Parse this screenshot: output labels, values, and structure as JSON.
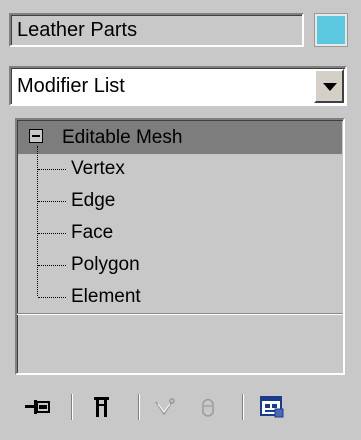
{
  "object_name": {
    "value": "Leather Parts",
    "color": "#5bc8e0"
  },
  "modifier_list": {
    "selected": "Modifier List"
  },
  "stack": {
    "root_label": "Editable Mesh",
    "expanded": true,
    "sub_objects": [
      {
        "label": "Vertex"
      },
      {
        "label": "Edge"
      },
      {
        "label": "Face"
      },
      {
        "label": "Polygon"
      },
      {
        "label": "Element"
      }
    ]
  },
  "toolbar": {
    "buttons": [
      {
        "icon": "pin-stack-icon",
        "enabled": true
      },
      {
        "icon": "show-end-result-icon",
        "enabled": true
      },
      {
        "icon": "make-unique-icon",
        "enabled": false
      },
      {
        "icon": "remove-modifier-icon",
        "enabled": false
      },
      {
        "icon": "configure-modifier-sets-icon",
        "enabled": true
      }
    ]
  }
}
